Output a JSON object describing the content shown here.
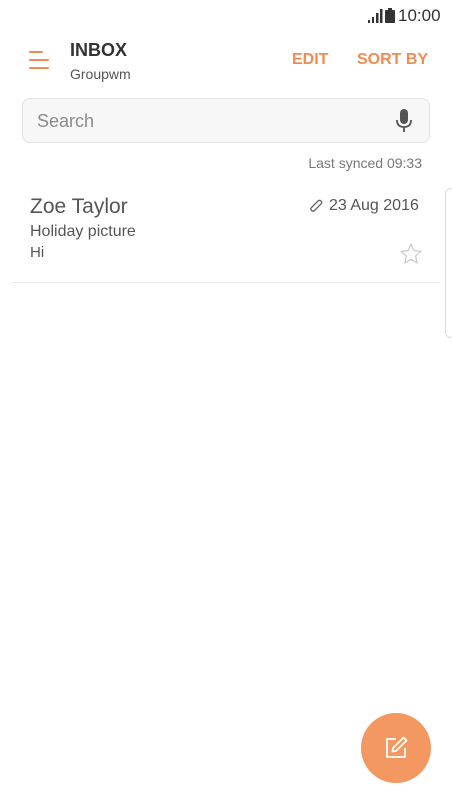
{
  "status_bar": {
    "time": "10:00",
    "signal_icon": "signal-icon",
    "battery_icon": "battery-icon"
  },
  "header": {
    "menu_icon": "hamburger-menu-icon",
    "title": "INBOX",
    "account": "Groupwm",
    "edit_label": "EDIT",
    "sort_label": "SORT BY"
  },
  "search": {
    "placeholder": "Search",
    "value": "",
    "mic_icon": "microphone-icon"
  },
  "sync": {
    "text": "Last synced  09:33"
  },
  "emails": [
    {
      "sender": "Zoe Taylor",
      "date": "23 Aug 2016",
      "subject": "Holiday picture",
      "preview": "Hi",
      "has_attachment": true,
      "starred": false
    }
  ],
  "compose": {
    "icon": "compose-icon"
  },
  "colors": {
    "accent": "#f28b52",
    "fab": "#f49862",
    "text": "#555555"
  }
}
